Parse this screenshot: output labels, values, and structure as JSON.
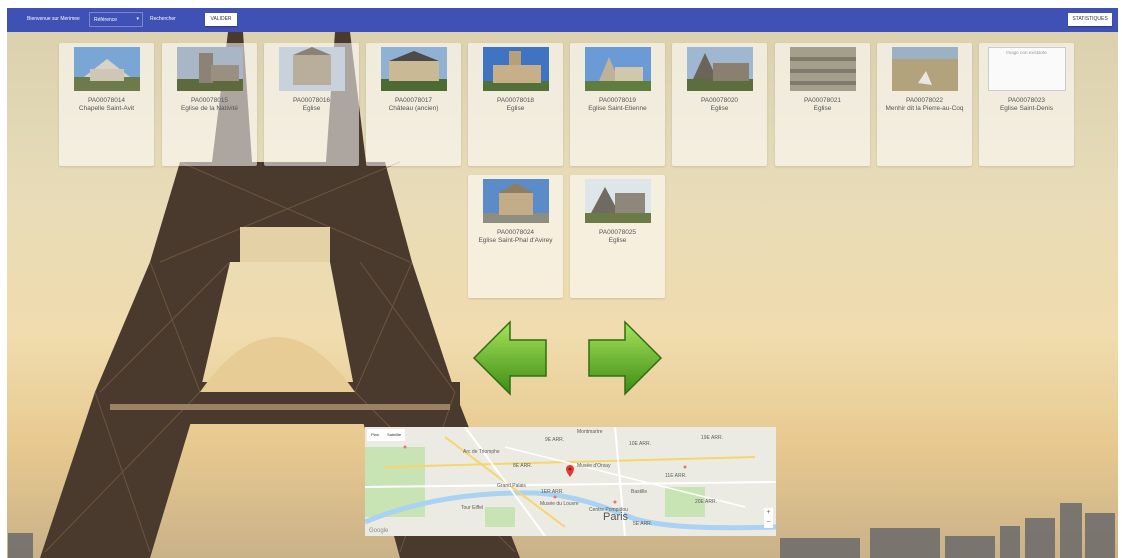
{
  "navbar": {
    "welcome": "Bienvenue sur Merimee",
    "select_value": "Référence",
    "search_label": "Rechercher",
    "validate_label": "VALIDER",
    "stats_label": "STATISTIQUES"
  },
  "cards": [
    {
      "ref": "PA00078014",
      "name": "Chapelle Saint-Avit"
    },
    {
      "ref": "PA00078015",
      "name": "Eglise de la Nativité"
    },
    {
      "ref": "PA00078016",
      "name": "Eglise"
    },
    {
      "ref": "PA00078017",
      "name": "Château (ancien)"
    },
    {
      "ref": "PA00078018",
      "name": "Eglise"
    },
    {
      "ref": "PA00078019",
      "name": "Eglise Saint-Etienne"
    },
    {
      "ref": "PA00078020",
      "name": "Eglise"
    },
    {
      "ref": "PA00078021",
      "name": "Eglise"
    },
    {
      "ref": "PA00078022",
      "name": "Menhir dit la Pierre-au-Coq"
    },
    {
      "ref": "PA00078023",
      "name": "Eglise Saint-Denis",
      "missing_image": "Image non existante"
    },
    {
      "ref": "PA00078024",
      "name": "Eglise Saint-Phal d'Avirey"
    },
    {
      "ref": "PA00078025",
      "name": "Eglise"
    }
  ],
  "map": {
    "tab_plan": "Plan",
    "tab_satellite": "Satellite",
    "labels": {
      "arc": "Arc de Triomphe",
      "musee_orsay": "Musée d'Orsay",
      "louvre": "Musée du Louvre",
      "grand_palais": "Grand Palais",
      "tour_eiffel": "Tour Eiffel",
      "pompidou": "Centre Pompidou",
      "bastille": "Bastille",
      "montmartre": "Montmartre",
      "arr_8": "8E ARR.",
      "arr_1": "1ER ARR.",
      "arr_9": "9E ARR.",
      "arr_10": "10E ARR.",
      "arr_11": "11E ARR.",
      "arr_19": "19E ARR.",
      "arr_20": "20E ARR.",
      "arr_5": "5E ARR."
    },
    "city": "Paris",
    "google": "Google",
    "zoom_in": "+",
    "zoom_out": "−"
  },
  "colors": {
    "navbar": "#3f51b5",
    "arrow_green": "#5cb82a",
    "marker": "#e53935"
  }
}
